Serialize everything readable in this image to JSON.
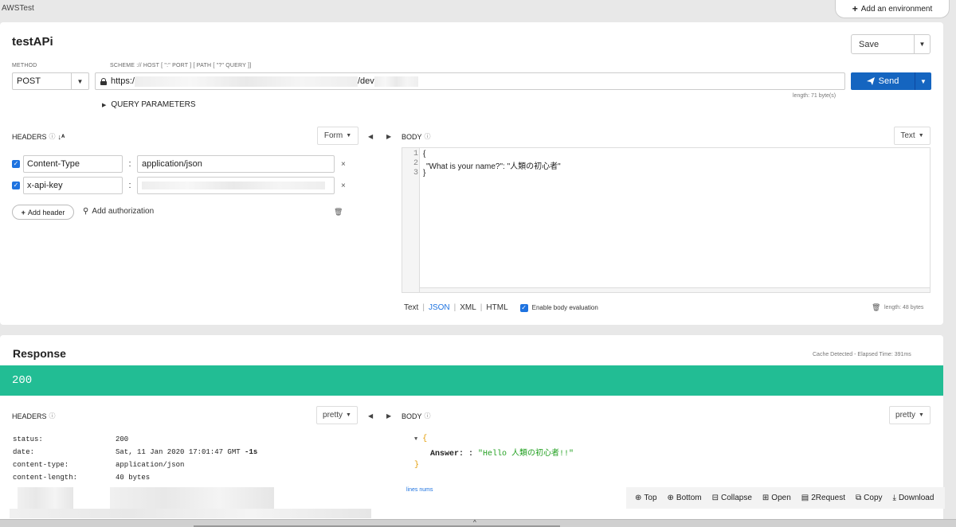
{
  "app": {
    "title": "AWSTest",
    "add_environment": "Add an environment"
  },
  "request": {
    "name": "testAPi",
    "save_label": "Save",
    "method_label": "METHOD",
    "method": "POST",
    "url_label": "SCHEME :// HOST [ \":\" PORT ] [ PATH [ \"?\" QUERY ]]",
    "url_scheme": "https:/",
    "url_path": "/dev",
    "send_label": "Send",
    "length": "length: 71 byte(s)",
    "query_parameters": "QUERY PARAMETERS",
    "headers_label": "HEADERS",
    "headers_mode": "Form",
    "headers": [
      {
        "key": "Content-Type",
        "value": "application/json"
      },
      {
        "key": "x-api-key",
        "value": ""
      }
    ],
    "add_header": "Add header",
    "add_authorization": "Add authorization",
    "body_label": "BODY",
    "body_mode": "Text",
    "body_lines": [
      "{",
      "\"What is your name?\": \"人類の初心者\"",
      "}"
    ],
    "line_numbers": [
      "1",
      "2",
      "3"
    ],
    "formats": [
      "Text",
      "JSON",
      "XML",
      "HTML"
    ],
    "active_format": "JSON",
    "enable_body_evaluation": "Enable body evaluation",
    "body_length": "length: 48 bytes"
  },
  "response": {
    "title": "Response",
    "cache_info": "Cache Detected - Elapsed Time: 391ms",
    "status_code": "200",
    "headers_label": "HEADERS",
    "headers_mode": "pretty",
    "headers": [
      {
        "key": "status:",
        "value": "200",
        "suffix": ""
      },
      {
        "key": "date:",
        "value": "Sat, 11 Jan 2020 17:01:47 GMT",
        "suffix": "-1s"
      },
      {
        "key": "content-type:",
        "value": "application/json",
        "suffix": ""
      },
      {
        "key": "content-length:",
        "value": "40 bytes",
        "suffix": ""
      }
    ],
    "body_label": "BODY",
    "body_mode": "pretty",
    "body_key": "Answer: :",
    "body_value": "\"Hello 人類の初心者!!\"",
    "lines_nums": "lines nums",
    "toolbar": [
      "Top",
      "Bottom",
      "Collapse",
      "Open",
      "2Request",
      "Copy",
      "Download"
    ]
  },
  "colors": {
    "accent": "#1565c0",
    "status_success": "#22bd94",
    "string_red": "#b31412",
    "string_green": "#22a020"
  },
  "icons": [
    "lock-icon",
    "send-icon",
    "sort-icon",
    "info-icon",
    "trash-icon",
    "key-icon",
    "chevron-down-icon"
  ]
}
